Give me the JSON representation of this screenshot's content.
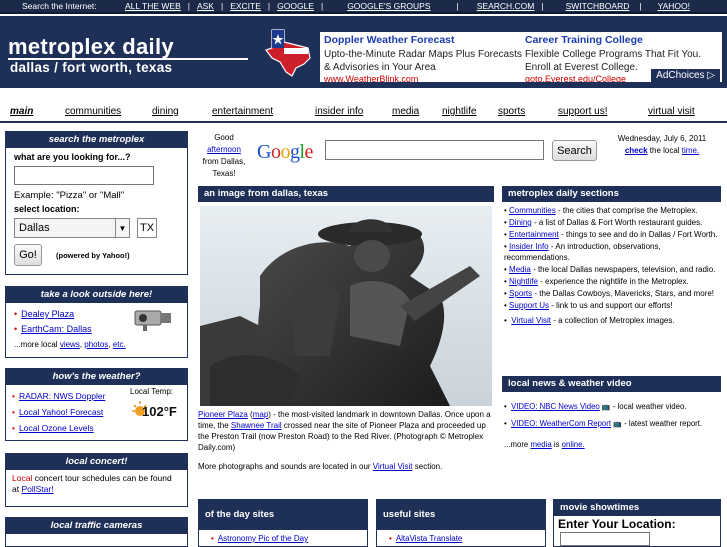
{
  "topbar": {
    "label": "Search the Internet:",
    "links": [
      "ALL THE WEB",
      "ASK",
      "EXCITE",
      "GOOGLE",
      "GOOGLE'S GROUPS",
      "SEARCH.COM",
      "SWITCHBOARD",
      "YAHOO!"
    ]
  },
  "header": {
    "logo_title": "metroplex daily",
    "logo_subtitle": "dallas / fort worth, texas",
    "ads": [
      {
        "title": "Doppler Weather Forecast",
        "text": "Upto-the-Minute Radar Maps Plus Forecasts & Advisories in Your Area",
        "url": "www.WeatherBlink.com"
      },
      {
        "title": "Career Training College",
        "text": "Flexible College Programs That Fit You. Enroll at Everest College.",
        "url": "goto.Everest.edu/College"
      }
    ],
    "adchoices": "AdChoices ▷"
  },
  "nav": {
    "items": [
      "main",
      "communities",
      "dining",
      "entertainment",
      "insider info",
      "media",
      "nightlife",
      "sports",
      "support us!",
      "virtual visit"
    ]
  },
  "search_box": {
    "header": "search the metroplex",
    "question": "what are you looking for...?",
    "example": "Example: \"Pizza\" or \"Mall\"",
    "location_label": "select location:",
    "city": "Dallas",
    "state": "TX",
    "go": "Go!",
    "powered": "(powered by Yahoo!)"
  },
  "greeting": {
    "good": "Good",
    "time_of_day": "afternoon",
    "from": "from Dallas, Texas!"
  },
  "google": {
    "logo": "Google",
    "button": "Search"
  },
  "date": {
    "day": "Wednesday, July 6, 2011",
    "check_word": "check",
    "rest": "the local",
    "time_word": "time."
  },
  "outside": {
    "header": "take a look outside here!",
    "links": [
      "Dealey Plaza",
      "EarthCam: Dallas"
    ],
    "more": "...more local",
    "more_links": [
      "views",
      "photos",
      "etc."
    ]
  },
  "weather": {
    "header": "how's the weather?",
    "links": [
      "RADAR: NWS Doppler",
      "Local Yahoo! Forecast",
      "Local Ozone Levels"
    ],
    "temp_label": "Local Temp:",
    "temp_value": "102°F"
  },
  "concerts": {
    "header": "local concert!",
    "text_a": "Local",
    "text_b": "concert tour schedules can be found at",
    "link": "PollStar!"
  },
  "traffic": {
    "header": "local traffic cameras"
  },
  "image_section": {
    "header": "an image from dallas, texas",
    "caption_link1": "Pioneer Plaza",
    "caption_link2": "map",
    "caption_a": "- the most-visited landmark in downtown Dallas. Once upon a time, the",
    "caption_link3": "Shawnee Trail",
    "caption_b": "crossed near the site of Pioneer Plaza and proceeded up the Preston Trail (now Preston Road) to the Red River. (Photograph © Metroplex Daily.com)",
    "more_a": "More photographs and sounds are located in our",
    "more_link": "Virtual Visit",
    "more_b": "section."
  },
  "sections": {
    "header": "metroplex daily sections",
    "items": [
      {
        "link": "Communities",
        "desc": "- the cities that comprise the Metroplex."
      },
      {
        "link": "Dining",
        "desc": "- a list of Dallas & Fort Worth restaurant guides."
      },
      {
        "link": "Entertainment",
        "desc": "- things to see and do in Dallas / Fort Worth."
      },
      {
        "link": "Insider Info",
        "desc": "- An introduction, observations, recommendations."
      },
      {
        "link": "Media",
        "desc": "- the local Dallas newspapers, television, and radio."
      },
      {
        "link": "Nightlife",
        "desc": "- experience the nightlife in the Metroplex."
      },
      {
        "link": "Sports",
        "desc": "- the Dallas Cowboys, Mavericks, Stars, and more!"
      },
      {
        "link": "Support Us",
        "desc": "- link to us and support our efforts!"
      },
      {
        "link": "Virtual Visit",
        "desc": "- a collection of Metroplex images."
      }
    ]
  },
  "news": {
    "header": "local news & weather video",
    "items": [
      {
        "link": "VIDEO: NBC News Video",
        "desc": "- local weather video."
      },
      {
        "link": "VIDEO: WeatherCom Report",
        "desc": "- latest weather report."
      }
    ],
    "more_a": "...more",
    "more_link1": "media",
    "more_b": "is",
    "more_link2": "online."
  },
  "bottom": {
    "day_sites": "of the day sites",
    "day_item": "Astronomy Pic of the Day",
    "useful": "useful sites",
    "useful_item": "AltaVista Translate",
    "movie": "movie showtimes",
    "enter_loc": "Enter Your Location:"
  }
}
